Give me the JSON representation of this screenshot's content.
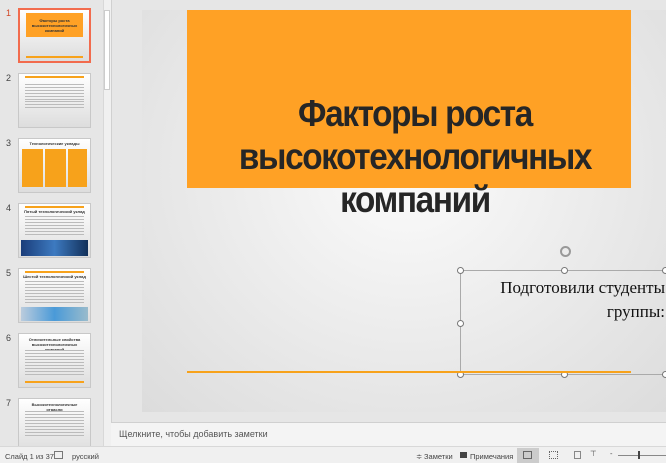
{
  "thumbnails": [
    {
      "num": "1",
      "title": "Факторы роста высокотехнологичных компаний"
    },
    {
      "num": "2",
      "title": ""
    },
    {
      "num": "3",
      "title": "Технологические уклады"
    },
    {
      "num": "4",
      "title": "Пятый технологический уклад"
    },
    {
      "num": "5",
      "title": "Шестой технологический уклад"
    },
    {
      "num": "6",
      "title": "Отличительные свойства высокотехнологичных компаний"
    },
    {
      "num": "7",
      "title": "Высокотехнологичные отрасли"
    }
  ],
  "slide": {
    "title": "Факторы роста высокотехнологичных компаний",
    "subtitle": "Подготовили студенты группы:"
  },
  "notes_placeholder": "Щелкните, чтобы добавить заметки",
  "status": {
    "slide": "Слайд 1 из 37",
    "language": "русский",
    "notes": "Заметки",
    "comments": "Примечания"
  },
  "colors": {
    "accent": "#ffa125",
    "selected": "#f26b4d"
  }
}
